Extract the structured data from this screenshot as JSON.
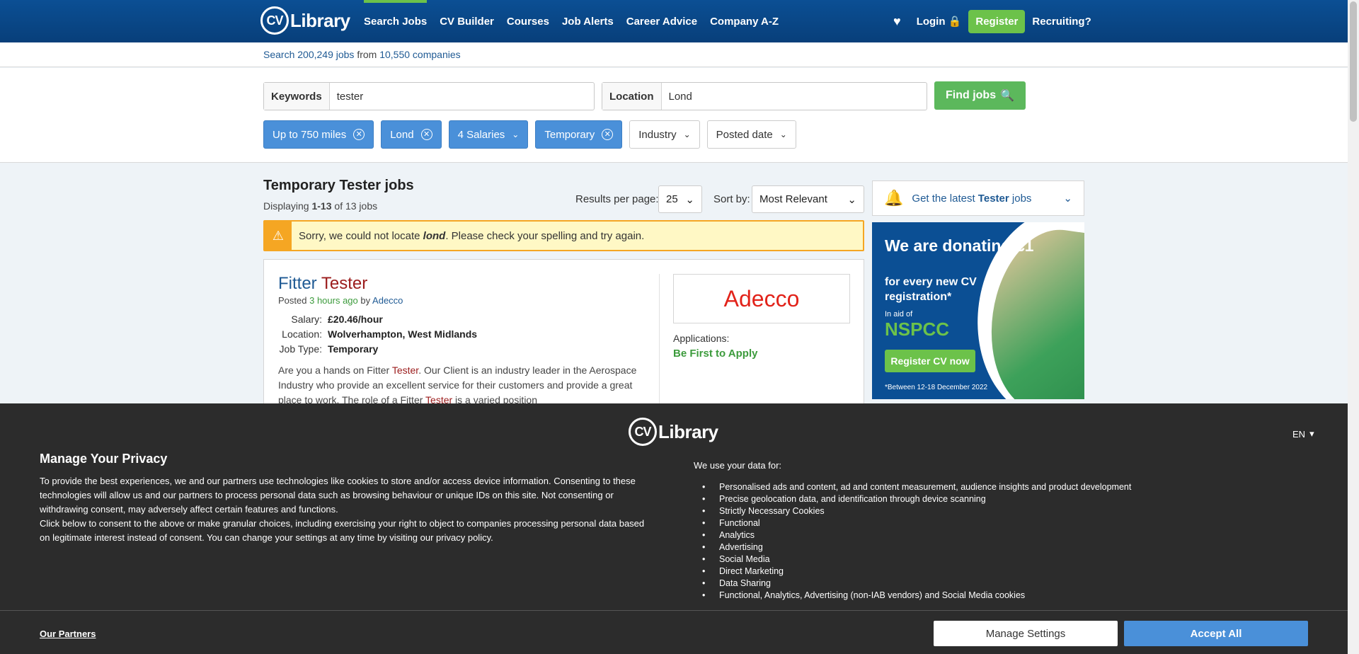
{
  "header": {
    "logo_cv": "CV",
    "logo_text": "Library",
    "nav": [
      "Search Jobs",
      "CV Builder",
      "Courses",
      "Job Alerts",
      "Career Advice",
      "Company A-Z"
    ],
    "login": "Login",
    "register": "Register",
    "recruiting": "Recruiting?"
  },
  "countbar": {
    "search": "Search",
    "jobs": "200,249 jobs",
    "from": "from",
    "companies": "10,550 companies"
  },
  "search": {
    "keywords_label": "Keywords",
    "keywords_value": "tester",
    "location_label": "Location",
    "location_value": "Lond",
    "find_button": "Find jobs"
  },
  "filters": {
    "distance": "Up to 750 miles",
    "location": "Lond",
    "salaries": "4 Salaries",
    "type": "Temporary",
    "industry": "Industry",
    "posted": "Posted date"
  },
  "results": {
    "title": "Temporary Tester jobs",
    "displaying_prefix": "Displaying",
    "displaying_range": "1-13",
    "displaying_suffix": "of 13 jobs",
    "rpp_label": "Results per page:",
    "rpp_value": "25",
    "sort_label": "Sort by:",
    "sort_value": "Most Relevant"
  },
  "alert": {
    "prefix": "Sorry, we could not locate",
    "term": "lond",
    "suffix": ". Please check your spelling and try again."
  },
  "job": {
    "title_a": "Fitter",
    "title_b": "Tester",
    "posted_prefix": "Posted",
    "posted_time": "3 hours ago",
    "posted_by": "by",
    "company": "Adecco",
    "salary_label": "Salary:",
    "salary": "£20.46/hour",
    "location_label": "Location:",
    "location": "Wolverhampton, West Midlands",
    "type_label": "Job Type:",
    "type": "Temporary",
    "desc_1": "Are you a hands on Fitter",
    "desc_hl1": "Tester",
    "desc_2": ". Our Client is an industry leader in the Aerospace Industry who provide an excellent service for their customers and provide a great place to work. The role of a Fitter",
    "desc_hl2": "Tester",
    "desc_3": "is a varied position",
    "logo_text": "Adecco",
    "apps_label": "Applications:",
    "apps_value": "Be First to Apply"
  },
  "sidebar": {
    "alert_prefix": "Get the latest",
    "alert_term": "Tester",
    "alert_suffix": "jobs",
    "promo_big": "We are donating £1",
    "promo_mid": "for every new CV registration*",
    "promo_aid": "In aid of",
    "promo_nspcc": "NSPCC",
    "promo_button": "Register CV now",
    "promo_foot": "*Between 12-18 December 2022"
  },
  "privacy": {
    "lang": "EN",
    "title": "Manage Your Privacy",
    "body_1": "To provide the best experiences, we and our partners use technologies like cookies to store and/or access device information. Consenting to these technologies will allow us and our partners to process personal data such as browsing behaviour or unique IDs on this site. Not consenting or withdrawing consent, may adversely affect certain features and functions.",
    "body_2": "Click below to consent to the above or make granular choices, including exercising your right to object to companies processing personal data based on legitimate interest instead of consent. You can change your settings at any time by visiting our privacy policy.",
    "uses_title": "We use your data for:",
    "uses": [
      "Personalised ads and content, ad and content measurement, audience insights and product development",
      "Precise geolocation data, and identification through device scanning",
      "Strictly Necessary Cookies",
      "Functional",
      "Analytics",
      "Advertising",
      "Social Media",
      "Direct Marketing",
      "Data Sharing",
      "Functional, Analytics, Advertising (non-IAB vendors) and Social Media cookies"
    ],
    "partners": "Our Partners",
    "manage": "Manage Settings",
    "accept": "Accept All"
  },
  "colors": {
    "brand_blue": "#0b4f94",
    "accent_green": "#6cc24a",
    "chip_blue": "#4a90d9",
    "alert_yellow": "#fff8c5",
    "alert_orange": "#f5a623"
  }
}
